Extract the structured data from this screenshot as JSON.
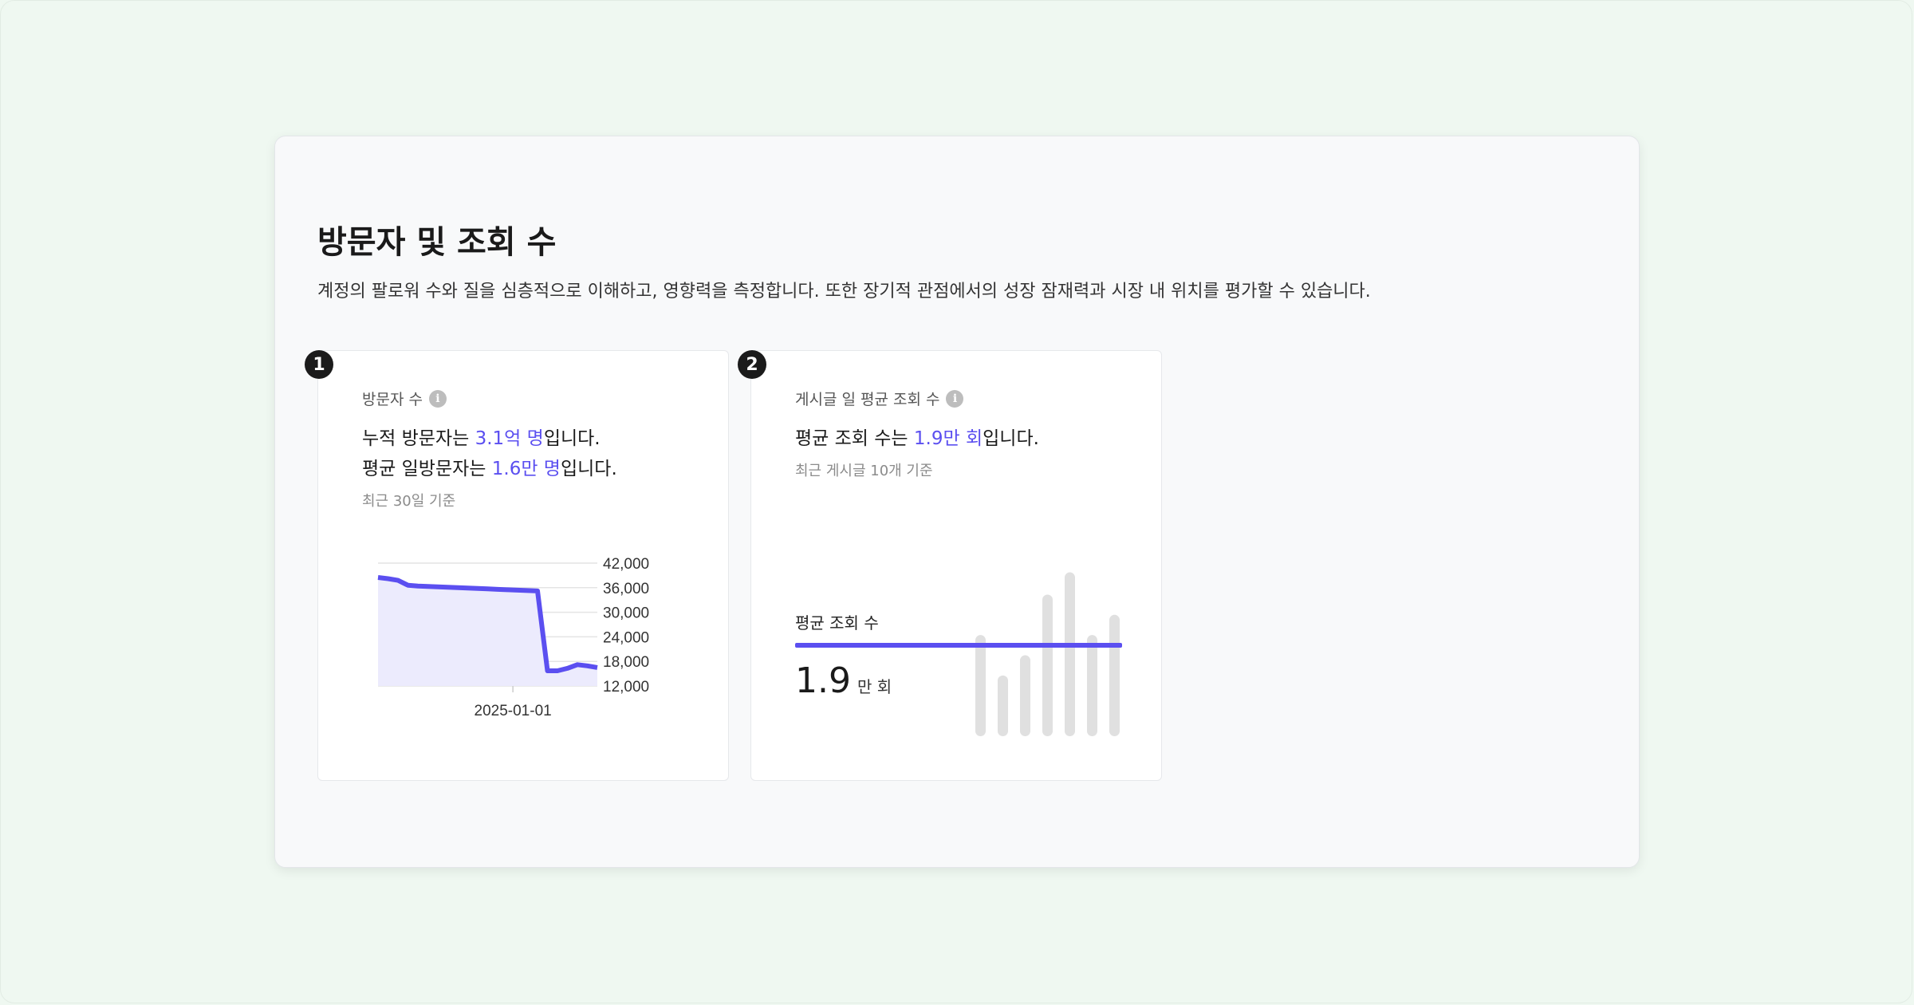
{
  "section": {
    "title": "방문자 및 조회 수",
    "description": "계정의 팔로워 수와 질을 심층적으로 이해하고, 영향력을 측정합니다. 또한 장기적 관점에서의 성장 잠재력과 시장 내 위치를 평가할 수 있습니다."
  },
  "cards": [
    {
      "badge": "1",
      "label": "방문자 수",
      "line1_prefix": "누적 방문자는 ",
      "line1_value": "3.1억 명",
      "line1_suffix": "입니다.",
      "line2_prefix": "평균 일방문자는 ",
      "line2_value": "1.6만 명",
      "line2_suffix": "입니다.",
      "note": "최근 30일 기준"
    },
    {
      "badge": "2",
      "label": "게시글 일 평균 조회 수",
      "line1_prefix": "평균 조회 수는 ",
      "line1_value": "1.9만 회",
      "line1_suffix": "입니다.",
      "note": "최근 게시글 10개 기준",
      "avg_label": "평균 조회 수",
      "big_number": "1.9",
      "big_unit": "만 회"
    }
  ],
  "icons": {
    "info": "info-icon"
  },
  "colors": {
    "accent": "#5b4ff0",
    "area_fill": "#ecebfd",
    "bar": "#e0e0e0"
  },
  "chart_data": [
    {
      "type": "area",
      "x_tick_labels": [
        "2025-01-01"
      ],
      "y_tick_labels": [
        "42,000",
        "36,000",
        "30,000",
        "24,000",
        "18,000",
        "12,000"
      ],
      "y_ticks": [
        42000,
        36000,
        30000,
        24000,
        18000,
        12000
      ],
      "ylim": [
        12000,
        42000
      ],
      "grid": true,
      "series": [
        {
          "values": [
            38500,
            38200,
            37800,
            36600,
            36400,
            36300,
            36200,
            36100,
            36000,
            35900,
            35800,
            35700,
            35600,
            35500,
            35400,
            35300,
            35200,
            15700,
            15700,
            16300,
            17200,
            16900,
            16500
          ]
        }
      ]
    },
    {
      "type": "bar",
      "values": [
        25000,
        15000,
        20000,
        35000,
        40500,
        25000,
        30000
      ],
      "average": 19000,
      "ylim": [
        0,
        41000
      ]
    }
  ]
}
